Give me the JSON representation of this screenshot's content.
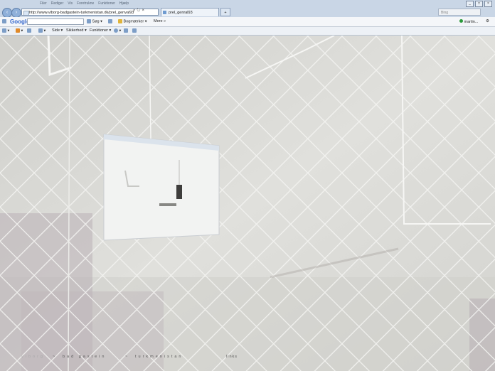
{
  "browser": {
    "menu_items": [
      "Filer",
      "Rediger",
      "Vis",
      "Foretrukne",
      "Funktioner",
      "Hjælp"
    ],
    "window_buttons": [
      "_",
      "□",
      "×"
    ],
    "address": "http://www.viborg-badgastein-turkmenistan.dk/",
    "address_tail": "prel_genval93",
    "tab1_label": "prel_genral93",
    "search_placeholder": "Bing"
  },
  "google_toolbar": {
    "logo": "Google",
    "search_label": "Søg",
    "bookmarks_label": "Bogmærker",
    "more_label": "Mere",
    "user_label": "martin..."
  },
  "command_bar": {
    "side_label": "Side",
    "security_label": "Sikkerhed",
    "tools_label": "Funktioner"
  },
  "footer_nav": {
    "home_label": "viborg",
    "middle_label": "bad gastein",
    "right_label": "turkmenistan",
    "links_label": "links",
    "separator": "~"
  }
}
